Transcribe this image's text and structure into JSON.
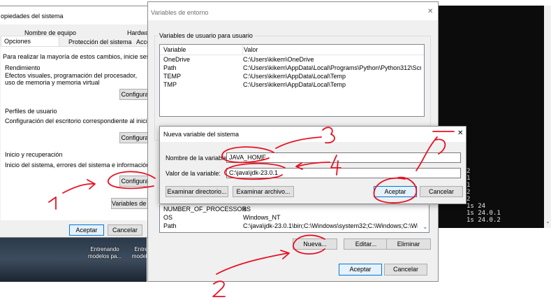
{
  "sysprops": {
    "title": "opiedades del sistema",
    "tabs": [
      "Nombre de equipo",
      "Hardwa",
      "Opciones avanzadas",
      "Protección del sistema",
      "Acce"
    ],
    "intro": "Para realizar la mayoría de estos cambios, inicie sesión como adm",
    "performance": {
      "label": "Rendimiento",
      "text": "Efectos visuales, programación del procesador, uso de memoria y memoria virtual",
      "button": "Configura"
    },
    "profiles": {
      "label": "Perfiles de usuario",
      "text": "Configuración del escritorio correspondiente al inicio de sesión",
      "button": "Configura"
    },
    "startup": {
      "label": "Inicio y recuperación",
      "text": "Inicio del sistema, errores del sistema e información de depuració",
      "button": "Configura"
    },
    "env_button": "Variables de e",
    "ok": "Aceptar",
    "cancel": "Cancelar"
  },
  "envvars": {
    "title": "Variables de entorno",
    "close": "✕",
    "user_group_label": "Variables de usuario para usuario",
    "col_variable": "Variable",
    "col_value": "Valor",
    "user_rows": [
      {
        "name": "OneDrive",
        "value": "C:\\Users\\kikem\\OneDrive"
      },
      {
        "name": "Path",
        "value": "C:\\Users\\kikem\\AppData\\Local\\Programs\\Python\\Python312\\Scrip..."
      },
      {
        "name": "TEMP",
        "value": "C:\\Users\\kikem\\AppData\\Local\\Temp"
      },
      {
        "name": "TMP",
        "value": "C:\\Users\\kikem\\AppData\\Local\\Temp"
      }
    ],
    "system_rows": [
      {
        "name": "NUMBER_OF_PROCESSORS",
        "value": "8"
      },
      {
        "name": "OS",
        "value": "Windows_NT"
      },
      {
        "name": "Path",
        "value": "C:\\java\\jdk-23.0.1\\bin;C:\\Windows\\system32;C:\\Windows;C:\\Wind..."
      }
    ],
    "new_button": "Nueva...",
    "edit_button": "Editar...",
    "delete_button": "Eliminar",
    "ok": "Aceptar",
    "cancel": "Cancelar"
  },
  "newvar": {
    "title": "Nueva variable del sistema",
    "close": "✕",
    "name_label": "Nombre de la variable:",
    "name_value": "JAVA_HOME",
    "value_label": "Valor de la variable:",
    "value_value": "C:\\java\\jdk-23.0.1",
    "browse_dir": "Examinar directorio...",
    "browse_file": "Examinar archivo...",
    "ok": "Aceptar",
    "cancel": "Cancelar"
  },
  "terminal": {
    "lines": [
      "2",
      "1",
      "1",
      "2",
      "2",
      "1s 24",
      "1s 24.0.1",
      "1s 24.0.2"
    ]
  },
  "desktop": {
    "icons": [
      {
        "label": "Entrenando modelos pa..."
      },
      {
        "label": "Entre modelo"
      }
    ]
  },
  "annotations": {
    "numbers": [
      "1",
      "2",
      "3",
      "4",
      "5"
    ],
    "color": "#e81123"
  }
}
